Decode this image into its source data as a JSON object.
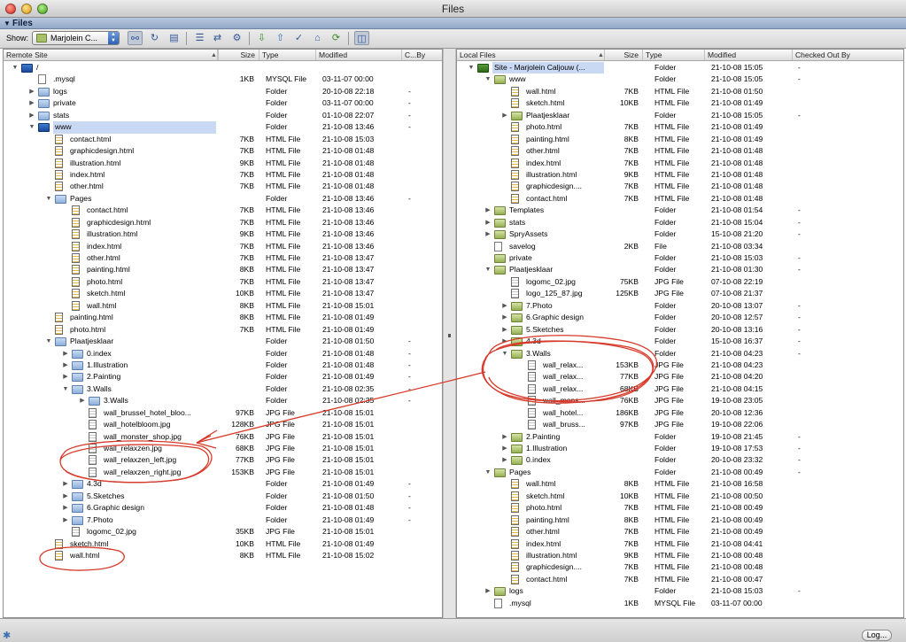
{
  "window": {
    "title": "Files"
  },
  "panel": {
    "title": "Files"
  },
  "toolbar": {
    "show_label": "Show:",
    "site_select": "Marjolein C..."
  },
  "left": {
    "columns": {
      "name": "Remote Site",
      "size": "Size",
      "type": "Type",
      "modified": "Modified",
      "checked": "C...By"
    },
    "rows": [
      {
        "d": 0,
        "disc": "open",
        "icon": "folder-site",
        "name": "/",
        "size": "",
        "type": "",
        "mod": "",
        "chk": ""
      },
      {
        "d": 1,
        "disc": "",
        "icon": "file",
        "name": ".mysql",
        "size": "1KB",
        "type": "MYSQL File",
        "mod": "03-11-07 00:00",
        "chk": ""
      },
      {
        "d": 1,
        "disc": "closed",
        "icon": "folder",
        "name": "logs",
        "size": "",
        "type": "Folder",
        "mod": "20-10-08 22:18",
        "chk": "-"
      },
      {
        "d": 1,
        "disc": "closed",
        "icon": "folder",
        "name": "private",
        "size": "",
        "type": "Folder",
        "mod": "03-11-07 00:00",
        "chk": "-"
      },
      {
        "d": 1,
        "disc": "closed",
        "icon": "folder",
        "name": "stats",
        "size": "",
        "type": "Folder",
        "mod": "01-10-08 22:07",
        "chk": "-"
      },
      {
        "d": 1,
        "disc": "open",
        "icon": "folder-site",
        "name": "www",
        "size": "",
        "type": "Folder",
        "mod": "21-10-08 13:46",
        "chk": "-",
        "hl": true
      },
      {
        "d": 2,
        "disc": "",
        "icon": "html",
        "name": "contact.html",
        "size": "7KB",
        "type": "HTML File",
        "mod": "21-10-08 15:03",
        "chk": ""
      },
      {
        "d": 2,
        "disc": "",
        "icon": "html",
        "name": "graphicdesign.html",
        "size": "7KB",
        "type": "HTML File",
        "mod": "21-10-08 01:48",
        "chk": ""
      },
      {
        "d": 2,
        "disc": "",
        "icon": "html",
        "name": "illustration.html",
        "size": "9KB",
        "type": "HTML File",
        "mod": "21-10-08 01:48",
        "chk": ""
      },
      {
        "d": 2,
        "disc": "",
        "icon": "html",
        "name": "index.html",
        "size": "7KB",
        "type": "HTML File",
        "mod": "21-10-08 01:48",
        "chk": ""
      },
      {
        "d": 2,
        "disc": "",
        "icon": "html",
        "name": "other.html",
        "size": "7KB",
        "type": "HTML File",
        "mod": "21-10-08 01:48",
        "chk": ""
      },
      {
        "d": 2,
        "disc": "open",
        "icon": "folder",
        "name": "Pages",
        "size": "",
        "type": "Folder",
        "mod": "21-10-08 13:46",
        "chk": "-"
      },
      {
        "d": 3,
        "disc": "",
        "icon": "html",
        "name": "contact.html",
        "size": "7KB",
        "type": "HTML File",
        "mod": "21-10-08 13:46",
        "chk": ""
      },
      {
        "d": 3,
        "disc": "",
        "icon": "html",
        "name": "graphicdesign.html",
        "size": "7KB",
        "type": "HTML File",
        "mod": "21-10-08 13:46",
        "chk": ""
      },
      {
        "d": 3,
        "disc": "",
        "icon": "html",
        "name": "illustration.html",
        "size": "9KB",
        "type": "HTML File",
        "mod": "21-10-08 13:46",
        "chk": ""
      },
      {
        "d": 3,
        "disc": "",
        "icon": "html",
        "name": "index.html",
        "size": "7KB",
        "type": "HTML File",
        "mod": "21-10-08 13:46",
        "chk": ""
      },
      {
        "d": 3,
        "disc": "",
        "icon": "html",
        "name": "other.html",
        "size": "7KB",
        "type": "HTML File",
        "mod": "21-10-08 13:47",
        "chk": ""
      },
      {
        "d": 3,
        "disc": "",
        "icon": "html",
        "name": "painting.html",
        "size": "8KB",
        "type": "HTML File",
        "mod": "21-10-08 13:47",
        "chk": ""
      },
      {
        "d": 3,
        "disc": "",
        "icon": "html",
        "name": "photo.html",
        "size": "7KB",
        "type": "HTML File",
        "mod": "21-10-08 13:47",
        "chk": ""
      },
      {
        "d": 3,
        "disc": "",
        "icon": "html",
        "name": "sketch.html",
        "size": "10KB",
        "type": "HTML File",
        "mod": "21-10-08 13:47",
        "chk": ""
      },
      {
        "d": 3,
        "disc": "",
        "icon": "html",
        "name": "wall.html",
        "size": "8KB",
        "type": "HTML File",
        "mod": "21-10-08 15:01",
        "chk": ""
      },
      {
        "d": 2,
        "disc": "",
        "icon": "html",
        "name": "painting.html",
        "size": "8KB",
        "type": "HTML File",
        "mod": "21-10-08 01:49",
        "chk": ""
      },
      {
        "d": 2,
        "disc": "",
        "icon": "html",
        "name": "photo.html",
        "size": "7KB",
        "type": "HTML File",
        "mod": "21-10-08 01:49",
        "chk": ""
      },
      {
        "d": 2,
        "disc": "open",
        "icon": "folder",
        "name": "Plaatjesklaar",
        "size": "",
        "type": "Folder",
        "mod": "21-10-08 01:50",
        "chk": "-"
      },
      {
        "d": 3,
        "disc": "closed",
        "icon": "folder",
        "name": "0.index",
        "size": "",
        "type": "Folder",
        "mod": "21-10-08 01:48",
        "chk": "-"
      },
      {
        "d": 3,
        "disc": "closed",
        "icon": "folder",
        "name": "1.Illustration",
        "size": "",
        "type": "Folder",
        "mod": "21-10-08 01:48",
        "chk": "-"
      },
      {
        "d": 3,
        "disc": "closed",
        "icon": "folder",
        "name": "2.Painting",
        "size": "",
        "type": "Folder",
        "mod": "21-10-08 01:49",
        "chk": "-"
      },
      {
        "d": 3,
        "disc": "open",
        "icon": "folder",
        "name": "3.Walls",
        "size": "",
        "type": "Folder",
        "mod": "21-10-08 02:35",
        "chk": "-"
      },
      {
        "d": 4,
        "disc": "closed",
        "icon": "folder",
        "name": "3.Walls",
        "size": "",
        "type": "Folder",
        "mod": "21-10-08 02:35",
        "chk": "-"
      },
      {
        "d": 4,
        "disc": "",
        "icon": "jpg",
        "name": "wall_brussel_hotel_bloo...",
        "size": "97KB",
        "type": "JPG File",
        "mod": "21-10-08 15:01",
        "chk": ""
      },
      {
        "d": 4,
        "disc": "",
        "icon": "jpg",
        "name": "wall_hotelbloom.jpg",
        "size": "128KB",
        "type": "JPG File",
        "mod": "21-10-08 15:01",
        "chk": ""
      },
      {
        "d": 4,
        "disc": "",
        "icon": "jpg",
        "name": "wall_monster_shop.jpg",
        "size": "76KB",
        "type": "JPG File",
        "mod": "21-10-08 15:01",
        "chk": ""
      },
      {
        "d": 4,
        "disc": "",
        "icon": "jpg",
        "name": "wall_relaxzen.jpg",
        "size": "68KB",
        "type": "JPG File",
        "mod": "21-10-08 15:01",
        "chk": ""
      },
      {
        "d": 4,
        "disc": "",
        "icon": "jpg",
        "name": "wall_relaxzen_left.jpg",
        "size": "77KB",
        "type": "JPG File",
        "mod": "21-10-08 15:01",
        "chk": ""
      },
      {
        "d": 4,
        "disc": "",
        "icon": "jpg",
        "name": "wall_relaxzen_right.jpg",
        "size": "153KB",
        "type": "JPG File",
        "mod": "21-10-08 15:01",
        "chk": ""
      },
      {
        "d": 3,
        "disc": "closed",
        "icon": "folder",
        "name": "4.3d",
        "size": "",
        "type": "Folder",
        "mod": "21-10-08 01:49",
        "chk": "-"
      },
      {
        "d": 3,
        "disc": "closed",
        "icon": "folder",
        "name": "5.Sketches",
        "size": "",
        "type": "Folder",
        "mod": "21-10-08 01:50",
        "chk": "-"
      },
      {
        "d": 3,
        "disc": "closed",
        "icon": "folder",
        "name": "6.Graphic design",
        "size": "",
        "type": "Folder",
        "mod": "21-10-08 01:48",
        "chk": "-"
      },
      {
        "d": 3,
        "disc": "closed",
        "icon": "folder",
        "name": "7.Photo",
        "size": "",
        "type": "Folder",
        "mod": "21-10-08 01:49",
        "chk": "-"
      },
      {
        "d": 3,
        "disc": "",
        "icon": "jpg",
        "name": "logomc_02.jpg",
        "size": "35KB",
        "type": "JPG File",
        "mod": "21-10-08 15:01",
        "chk": ""
      },
      {
        "d": 2,
        "disc": "",
        "icon": "html",
        "name": "sketch.html",
        "size": "10KB",
        "type": "HTML File",
        "mod": "21-10-08 01:49",
        "chk": ""
      },
      {
        "d": 2,
        "disc": "",
        "icon": "html",
        "name": "wall.html",
        "size": "8KB",
        "type": "HTML File",
        "mod": "21-10-08 15:02",
        "chk": ""
      }
    ]
  },
  "right": {
    "columns": {
      "name": "Local Files",
      "size": "Size",
      "type": "Type",
      "modified": "Modified",
      "checked": "Checked Out By"
    },
    "rows": [
      {
        "d": 0,
        "disc": "open",
        "icon": "folder-sitegreen",
        "name": "Site - Marjolein Caljouw (...",
        "size": "",
        "type": "Folder",
        "mod": "21-10-08 15:05",
        "chk": "-",
        "hl": true
      },
      {
        "d": 1,
        "disc": "open",
        "icon": "folder-green",
        "name": "www",
        "size": "",
        "type": "Folder",
        "mod": "21-10-08 15:05",
        "chk": "-"
      },
      {
        "d": 2,
        "disc": "",
        "icon": "html",
        "name": "wall.html",
        "size": "7KB",
        "type": "HTML File",
        "mod": "21-10-08 01:50",
        "chk": ""
      },
      {
        "d": 2,
        "disc": "",
        "icon": "html",
        "name": "sketch.html",
        "size": "10KB",
        "type": "HTML File",
        "mod": "21-10-08 01:49",
        "chk": ""
      },
      {
        "d": 2,
        "disc": "closed",
        "icon": "folder-green",
        "name": "Plaatjesklaar",
        "size": "",
        "type": "Folder",
        "mod": "21-10-08 15:05",
        "chk": "-"
      },
      {
        "d": 2,
        "disc": "",
        "icon": "html",
        "name": "photo.html",
        "size": "7KB",
        "type": "HTML File",
        "mod": "21-10-08 01:49",
        "chk": ""
      },
      {
        "d": 2,
        "disc": "",
        "icon": "html",
        "name": "painting.html",
        "size": "8KB",
        "type": "HTML File",
        "mod": "21-10-08 01:49",
        "chk": ""
      },
      {
        "d": 2,
        "disc": "",
        "icon": "html",
        "name": "other.html",
        "size": "7KB",
        "type": "HTML File",
        "mod": "21-10-08 01:48",
        "chk": ""
      },
      {
        "d": 2,
        "disc": "",
        "icon": "html",
        "name": "index.html",
        "size": "7KB",
        "type": "HTML File",
        "mod": "21-10-08 01:48",
        "chk": ""
      },
      {
        "d": 2,
        "disc": "",
        "icon": "html",
        "name": "illustration.html",
        "size": "9KB",
        "type": "HTML File",
        "mod": "21-10-08 01:48",
        "chk": ""
      },
      {
        "d": 2,
        "disc": "",
        "icon": "html",
        "name": "graphicdesign....",
        "size": "7KB",
        "type": "HTML File",
        "mod": "21-10-08 01:48",
        "chk": ""
      },
      {
        "d": 2,
        "disc": "",
        "icon": "html",
        "name": "contact.html",
        "size": "7KB",
        "type": "HTML File",
        "mod": "21-10-08 01:48",
        "chk": ""
      },
      {
        "d": 1,
        "disc": "closed",
        "icon": "folder-green",
        "name": "Templates",
        "size": "",
        "type": "Folder",
        "mod": "21-10-08 01:54",
        "chk": "-"
      },
      {
        "d": 1,
        "disc": "closed",
        "icon": "folder-green",
        "name": "stats",
        "size": "",
        "type": "Folder",
        "mod": "21-10-08 15:04",
        "chk": "-"
      },
      {
        "d": 1,
        "disc": "closed",
        "icon": "folder-green",
        "name": "SpryAssets",
        "size": "",
        "type": "Folder",
        "mod": "15-10-08 21:20",
        "chk": "-"
      },
      {
        "d": 1,
        "disc": "",
        "icon": "file",
        "name": "savelog",
        "size": "2KB",
        "type": "File",
        "mod": "21-10-08 03:34",
        "chk": ""
      },
      {
        "d": 1,
        "disc": "",
        "icon": "folder-green",
        "name": "private",
        "size": "",
        "type": "Folder",
        "mod": "21-10-08 15:03",
        "chk": "-"
      },
      {
        "d": 1,
        "disc": "open",
        "icon": "folder-green",
        "name": "Plaatjesklaar",
        "size": "",
        "type": "Folder",
        "mod": "21-10-08 01:30",
        "chk": "-"
      },
      {
        "d": 2,
        "disc": "",
        "icon": "jpg",
        "name": "logomc_02.jpg",
        "size": "75KB",
        "type": "JPG File",
        "mod": "07-10-08 22:19",
        "chk": ""
      },
      {
        "d": 2,
        "disc": "",
        "icon": "jpg",
        "name": "logo_125_87.jpg",
        "size": "125KB",
        "type": "JPG File",
        "mod": "07-10-08 21:37",
        "chk": ""
      },
      {
        "d": 2,
        "disc": "closed",
        "icon": "folder-green",
        "name": "7.Photo",
        "size": "",
        "type": "Folder",
        "mod": "20-10-08 13:07",
        "chk": "-"
      },
      {
        "d": 2,
        "disc": "closed",
        "icon": "folder-green",
        "name": "6.Graphic design",
        "size": "",
        "type": "Folder",
        "mod": "20-10-08 12:57",
        "chk": "-"
      },
      {
        "d": 2,
        "disc": "closed",
        "icon": "folder-green",
        "name": "5.Sketches",
        "size": "",
        "type": "Folder",
        "mod": "20-10-08 13:16",
        "chk": "-"
      },
      {
        "d": 2,
        "disc": "closed",
        "icon": "folder-green",
        "name": "4.3d",
        "size": "",
        "type": "Folder",
        "mod": "15-10-08 16:37",
        "chk": "-"
      },
      {
        "d": 2,
        "disc": "open",
        "icon": "folder-green",
        "name": "3.Walls",
        "size": "",
        "type": "Folder",
        "mod": "21-10-08 04:23",
        "chk": "-"
      },
      {
        "d": 3,
        "disc": "",
        "icon": "jpg",
        "name": "wall_relax...",
        "size": "153KB",
        "type": "JPG File",
        "mod": "21-10-08 04:23",
        "chk": ""
      },
      {
        "d": 3,
        "disc": "",
        "icon": "jpg",
        "name": "wall_relax...",
        "size": "77KB",
        "type": "JPG File",
        "mod": "21-10-08 04:20",
        "chk": ""
      },
      {
        "d": 3,
        "disc": "",
        "icon": "jpg",
        "name": "wall_relax...",
        "size": "68KB",
        "type": "JPG File",
        "mod": "21-10-08 04:15",
        "chk": ""
      },
      {
        "d": 3,
        "disc": "",
        "icon": "jpg",
        "name": "wall_mons...",
        "size": "76KB",
        "type": "JPG File",
        "mod": "19-10-08 23:05",
        "chk": ""
      },
      {
        "d": 3,
        "disc": "",
        "icon": "jpg",
        "name": "wall_hotel...",
        "size": "186KB",
        "type": "JPG File",
        "mod": "20-10-08 12:36",
        "chk": ""
      },
      {
        "d": 3,
        "disc": "",
        "icon": "jpg",
        "name": "wall_bruss...",
        "size": "97KB",
        "type": "JPG File",
        "mod": "19-10-08 22:06",
        "chk": ""
      },
      {
        "d": 2,
        "disc": "closed",
        "icon": "folder-green",
        "name": "2.Painting",
        "size": "",
        "type": "Folder",
        "mod": "19-10-08 21:45",
        "chk": "-"
      },
      {
        "d": 2,
        "disc": "closed",
        "icon": "folder-green",
        "name": "1.Illustration",
        "size": "",
        "type": "Folder",
        "mod": "19-10-08 17:53",
        "chk": "-"
      },
      {
        "d": 2,
        "disc": "closed",
        "icon": "folder-green",
        "name": "0.index",
        "size": "",
        "type": "Folder",
        "mod": "20-10-08 23:32",
        "chk": "-"
      },
      {
        "d": 1,
        "disc": "open",
        "icon": "folder-green",
        "name": "Pages",
        "size": "",
        "type": "Folder",
        "mod": "21-10-08 00:49",
        "chk": "-"
      },
      {
        "d": 2,
        "disc": "",
        "icon": "html",
        "name": "wall.html",
        "size": "8KB",
        "type": "HTML File",
        "mod": "21-10-08 16:58",
        "chk": ""
      },
      {
        "d": 2,
        "disc": "",
        "icon": "html",
        "name": "sketch.html",
        "size": "10KB",
        "type": "HTML File",
        "mod": "21-10-08 00:50",
        "chk": ""
      },
      {
        "d": 2,
        "disc": "",
        "icon": "html",
        "name": "photo.html",
        "size": "7KB",
        "type": "HTML File",
        "mod": "21-10-08 00:49",
        "chk": ""
      },
      {
        "d": 2,
        "disc": "",
        "icon": "html",
        "name": "painting.html",
        "size": "8KB",
        "type": "HTML File",
        "mod": "21-10-08 00:49",
        "chk": ""
      },
      {
        "d": 2,
        "disc": "",
        "icon": "html",
        "name": "other.html",
        "size": "7KB",
        "type": "HTML File",
        "mod": "21-10-08 00:49",
        "chk": ""
      },
      {
        "d": 2,
        "disc": "",
        "icon": "html",
        "name": "index.html",
        "size": "7KB",
        "type": "HTML File",
        "mod": "21-10-08 04:41",
        "chk": ""
      },
      {
        "d": 2,
        "disc": "",
        "icon": "html",
        "name": "illustration.html",
        "size": "9KB",
        "type": "HTML File",
        "mod": "21-10-08 00:48",
        "chk": ""
      },
      {
        "d": 2,
        "disc": "",
        "icon": "html",
        "name": "graphicdesign....",
        "size": "7KB",
        "type": "HTML File",
        "mod": "21-10-08 00:48",
        "chk": ""
      },
      {
        "d": 2,
        "disc": "",
        "icon": "html",
        "name": "contact.html",
        "size": "7KB",
        "type": "HTML File",
        "mod": "21-10-08 00:47",
        "chk": ""
      },
      {
        "d": 1,
        "disc": "closed",
        "icon": "folder-green",
        "name": "logs",
        "size": "",
        "type": "Folder",
        "mod": "21-10-08 15:03",
        "chk": "-"
      },
      {
        "d": 1,
        "disc": "",
        "icon": "file",
        "name": ".mysql",
        "size": "1KB",
        "type": "MYSQL File",
        "mod": "03-11-07 00:00",
        "chk": ""
      }
    ]
  },
  "status": {
    "log_button": "Log..."
  },
  "colors": {
    "annotation": "#d63a2a",
    "selection": "#c9d9f3"
  }
}
